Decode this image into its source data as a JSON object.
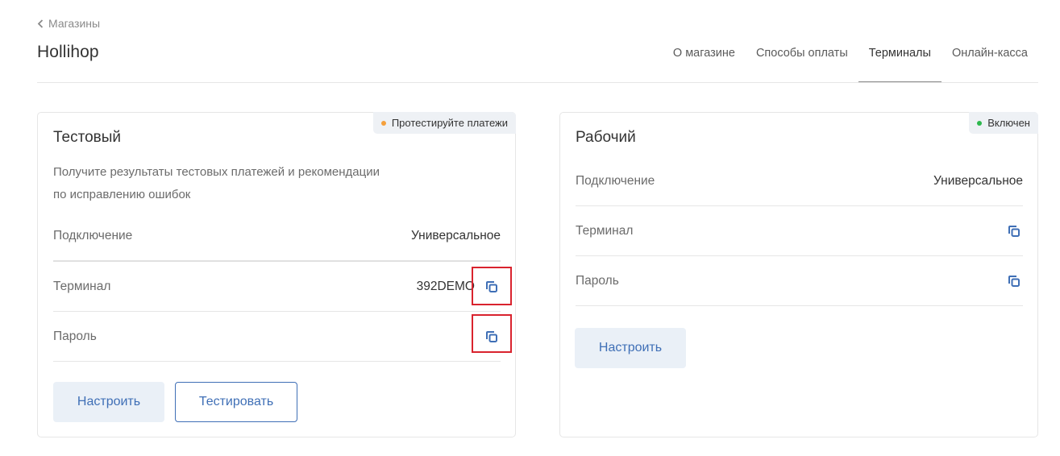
{
  "header": {
    "back_label": "Магазины",
    "title": "Hollihop",
    "tabs": [
      {
        "label": "О магазине",
        "active": false
      },
      {
        "label": "Способы оплаты",
        "active": false
      },
      {
        "label": "Терминалы",
        "active": true
      },
      {
        "label": "Онлайн-касса",
        "active": false
      }
    ]
  },
  "colors": {
    "accent": "#3f6fb6",
    "test_badge_dot": "#f5a03c",
    "prod_badge_dot": "#2db84d",
    "highlight": "#d9232e"
  },
  "test_card": {
    "badge": "Протестируйте платежи",
    "title": "Тестовый",
    "description_line1": "Получите результаты тестовых платежей и рекомендации",
    "description_line2": "по исправлению ошибок",
    "rows": [
      {
        "label": "Подключение",
        "value": "Универсальное"
      },
      {
        "label": "Терминал",
        "value": "392DEMO",
        "icon": "copy-icon"
      },
      {
        "label": "Пароль",
        "value": "",
        "icon": "copy-icon"
      }
    ],
    "configure_button": "Настроить",
    "test_button": "Тестировать"
  },
  "prod_card": {
    "badge": "Включен",
    "title": "Рабочий",
    "rows": [
      {
        "label": "Подключение",
        "value": "Универсальное"
      },
      {
        "label": "Терминал",
        "value": "",
        "icon": "copy-icon"
      },
      {
        "label": "Пароль",
        "value": "",
        "icon": "copy-icon"
      }
    ],
    "configure_button": "Настроить"
  }
}
